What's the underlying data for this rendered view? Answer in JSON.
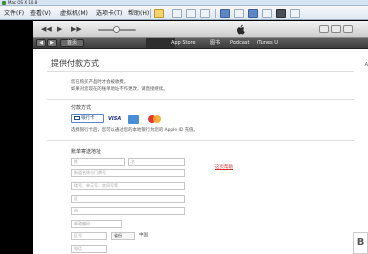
{
  "window": {
    "title": "Mac OS X 10.8"
  },
  "vm_menu": {
    "items": [
      "文件(F)",
      "查看(V)",
      "虚拟机(M)",
      "选项卡(T)",
      "帮助(H)"
    ]
  },
  "itunes_nav": {
    "back": "◀",
    "forward": "▶",
    "home": "首页",
    "links": [
      "App Store",
      "图书",
      "Podcast",
      "iTunes U"
    ]
  },
  "page": {
    "title": "提供付款方式",
    "edge_label": "A",
    "notes": [
      "您在购买产品时才会被收费。",
      "如果对您现在的账单地址不作更改，请直接继续。"
    ],
    "payment": {
      "section_label": "付款方式",
      "selected_option": "银行卡",
      "options": [
        "VISA",
        "AMEX",
        "MasterCard"
      ],
      "note": "选择银行卡后，您可以通过您的本地银行为您的 Apple ID 充值。"
    },
    "billing": {
      "section_label": "账单寄送地址",
      "placeholders": {
        "last_name": "姓",
        "first_name": "名",
        "address1": "街道名称与门牌号",
        "address2": "楼号、单元号、房间号等",
        "district": "区",
        "city": "市",
        "postal": "邮政编码",
        "province": "省份",
        "phone": "电话"
      },
      "area_code_placeholder": "区号",
      "country": "中国",
      "help_link": "这页帮助"
    }
  },
  "colors": {
    "accent_blue": "#5d86c5",
    "link_red": "#d43030",
    "nav_dark": "#3c3c3c"
  },
  "icons": {
    "watermark": "B"
  }
}
